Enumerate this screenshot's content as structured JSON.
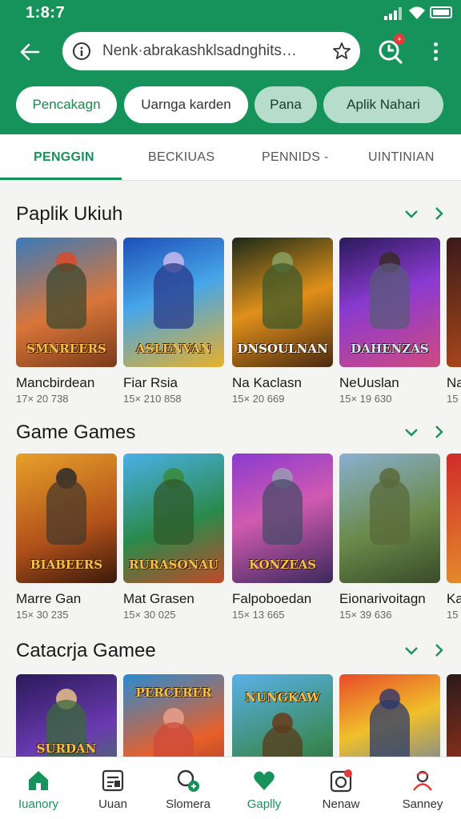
{
  "status": {
    "time": "1:8:7"
  },
  "search": {
    "text": "Nenk·abrakashklsadnghits…",
    "badge": "+"
  },
  "chips": [
    "Pencakagn",
    "Uarnga karden",
    "Pana",
    "Aplik Nahari"
  ],
  "tabs": [
    "PENGGIN",
    "BECKIUAS",
    "PENNIDS -",
    "UINTINIAN"
  ],
  "sections": [
    {
      "title": "Paplik Ukiuh",
      "cards": [
        {
          "art": "SMNREERS",
          "name": "Mancbirdean",
          "meta": "17× 20 738"
        },
        {
          "art": "ASLENVAN",
          "name": "Fiar Rsia",
          "meta": "15× 210 858"
        },
        {
          "art": "DNSOULNAN",
          "name": "Na Kaclasn",
          "meta": "15× 20 669"
        },
        {
          "art": "DAHENZAS",
          "name": "NeUuslan",
          "meta": "15× 19 630"
        },
        {
          "art": "",
          "name": "Na",
          "meta": "15"
        }
      ]
    },
    {
      "title": "Game Games",
      "cards": [
        {
          "art": "BIABEERS",
          "name": "Marre Gan",
          "meta": "15× 30 235"
        },
        {
          "art": "RURASONAU",
          "name": "Mat Grasen",
          "meta": "15× 30 025"
        },
        {
          "art": "KONZEAS",
          "name": "Falpoboedan",
          "meta": "15× 13 665"
        },
        {
          "art": "",
          "name": "Eionarivoitagn",
          "meta": "15× 39 636"
        },
        {
          "art": "",
          "name": "Ka",
          "meta": "15"
        }
      ]
    },
    {
      "title": "Catacrja Gamee",
      "cards": [
        {
          "art": "SURDAN",
          "name": "",
          "meta": ""
        },
        {
          "art": "PERCERER",
          "name": "",
          "meta": ""
        },
        {
          "art": "NUNGKAW",
          "name": "",
          "meta": ""
        },
        {
          "art": "",
          "name": "",
          "meta": ""
        },
        {
          "art": "",
          "name": "",
          "meta": ""
        }
      ]
    }
  ],
  "nav": [
    {
      "label": "Iuanory",
      "icon": "home-icon"
    },
    {
      "label": "Uuan",
      "icon": "apps-icon"
    },
    {
      "label": "Slomera",
      "icon": "search-badge-icon"
    },
    {
      "label": "Gaplly",
      "icon": "heart-icon"
    },
    {
      "label": "Nenaw",
      "icon": "notification-icon"
    },
    {
      "label": "Sanney",
      "icon": "profile-icon"
    }
  ],
  "colors": {
    "brand": "#16935a",
    "chip_active": "#b6dccb",
    "badge": "#e23b3b"
  }
}
